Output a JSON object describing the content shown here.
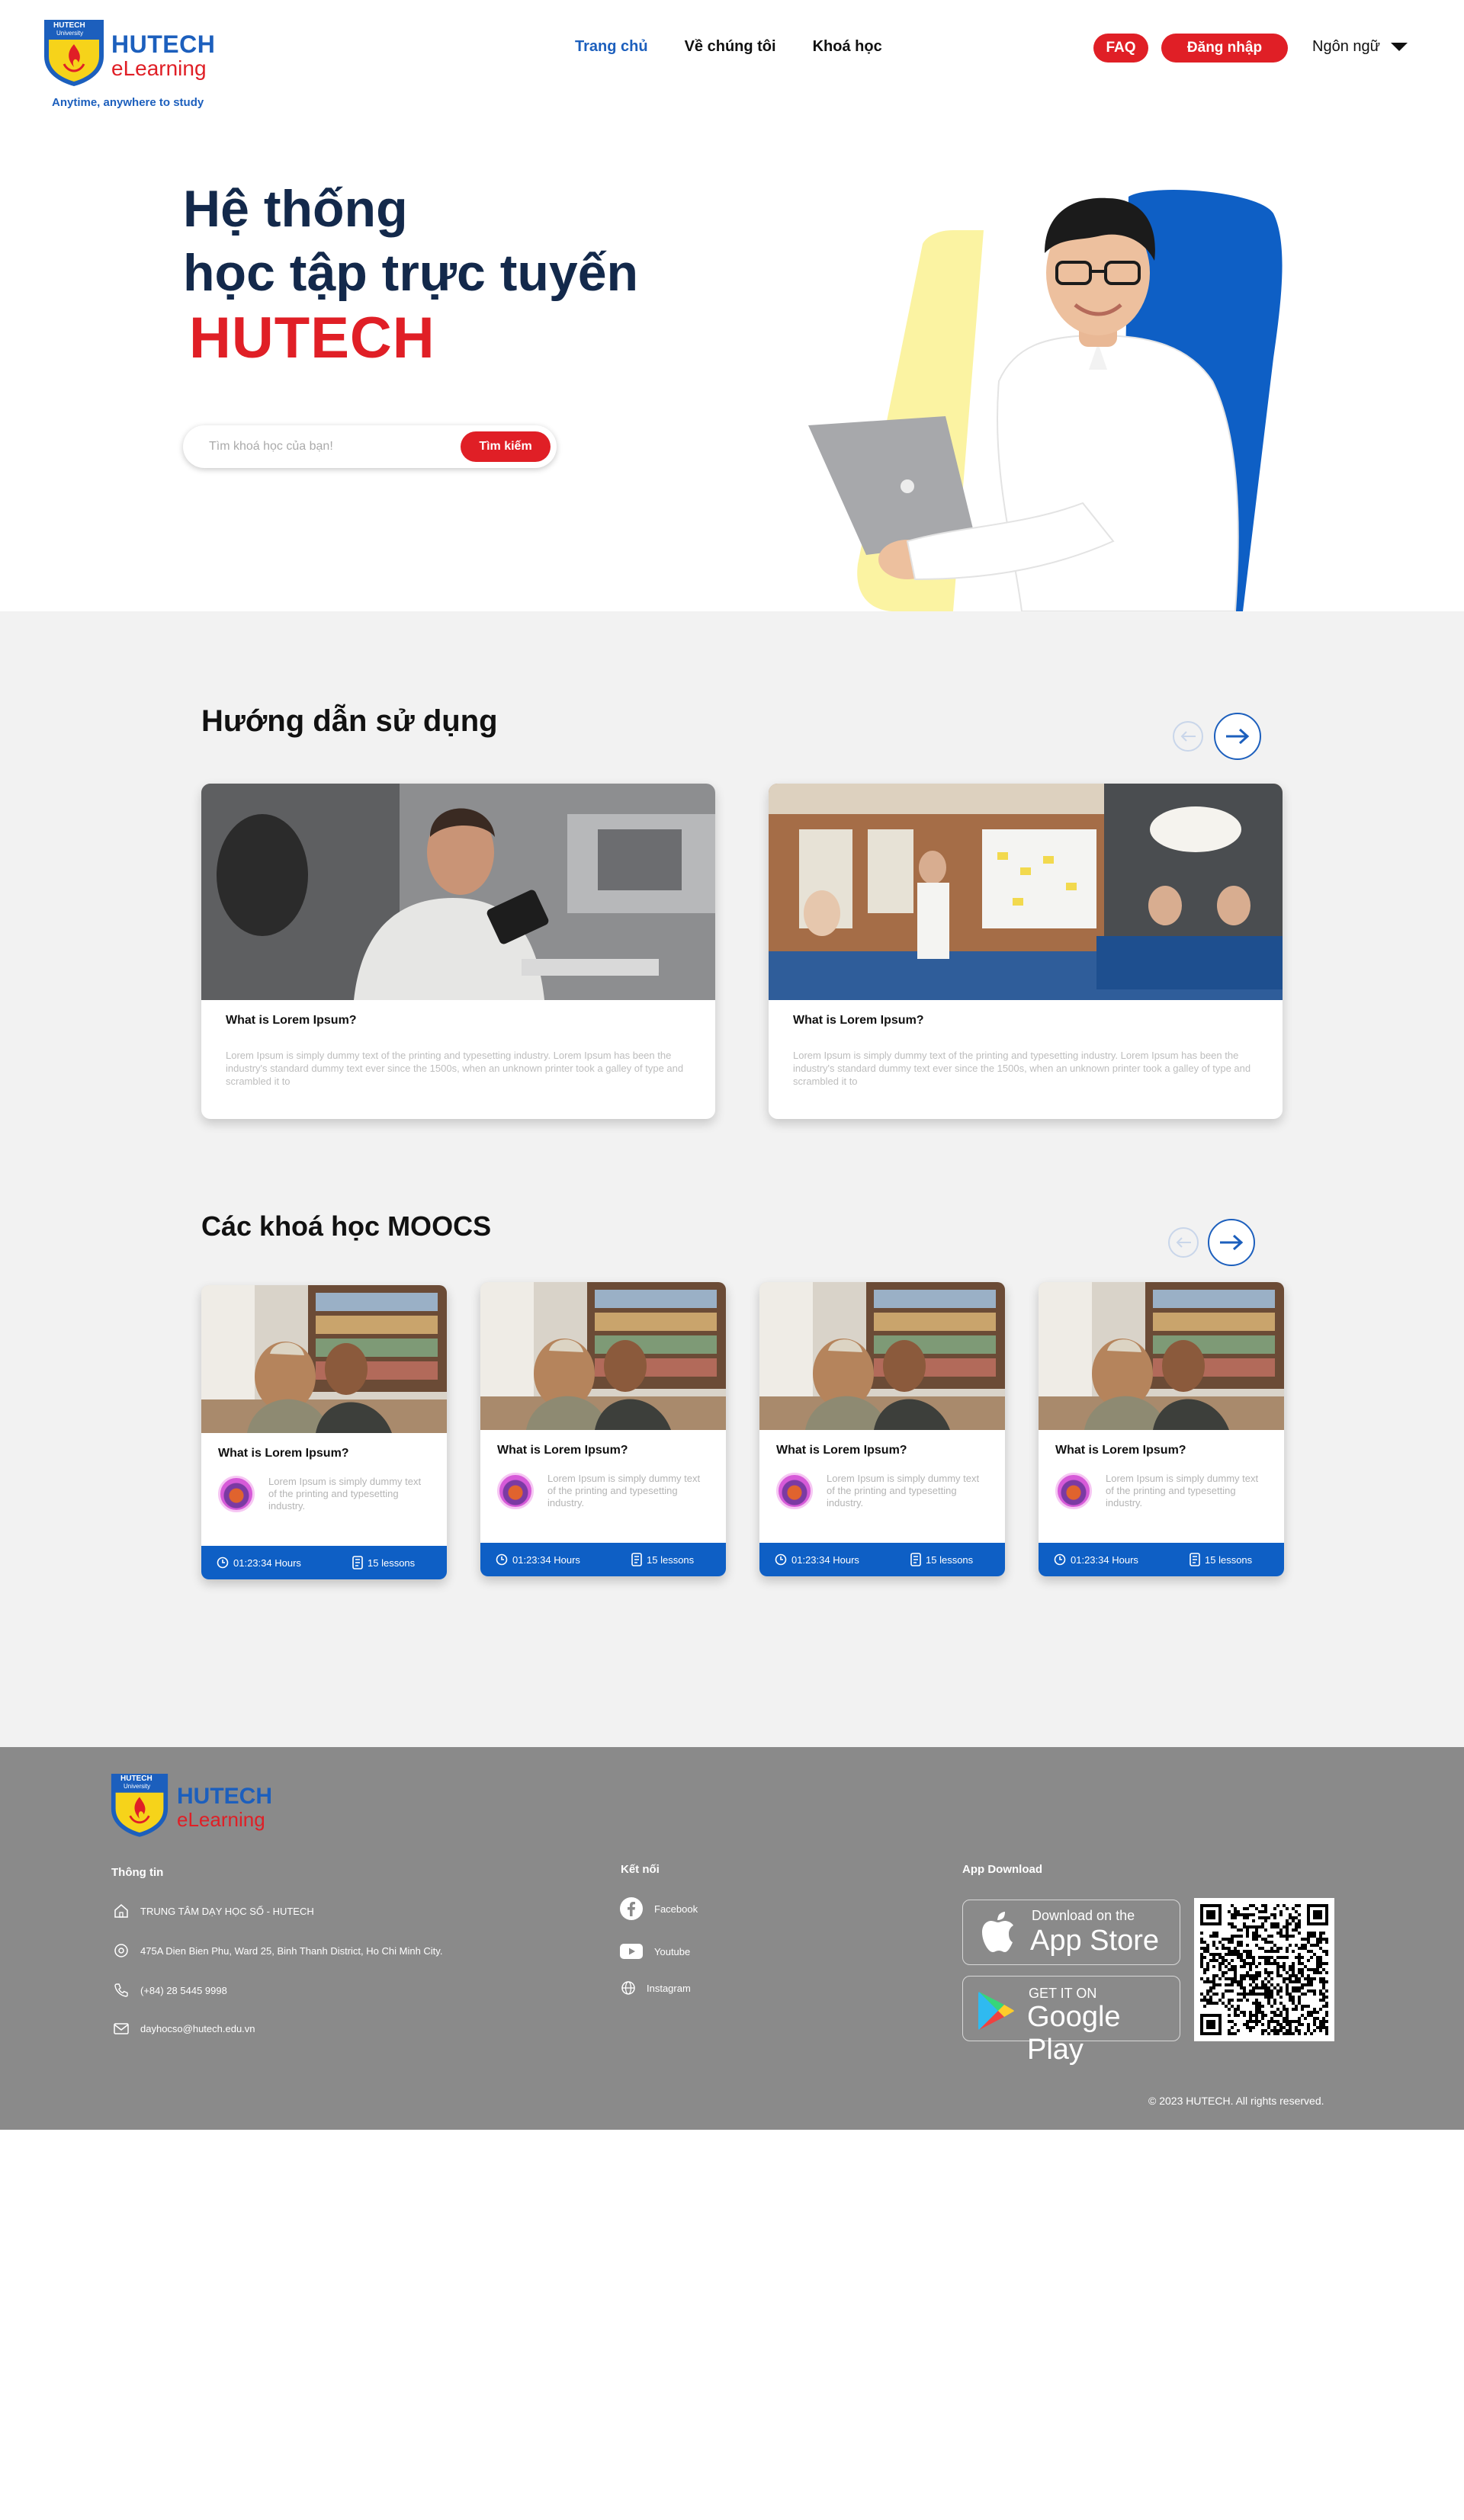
{
  "brand": {
    "badge_line1": "HUTECH",
    "badge_line2": "University",
    "name": "HUTECH",
    "product": "eLearning",
    "tagline": "Anytime, anywhere to study",
    "colors": {
      "blue": "#1c5fbd",
      "red": "#e01f26",
      "navy": "#13294b"
    }
  },
  "nav": {
    "items": [
      {
        "label": "Trang chủ",
        "active": true
      },
      {
        "label": "Về chúng tôi",
        "active": false
      },
      {
        "label": "Khoá học",
        "active": false
      }
    ],
    "faq_label": "FAQ",
    "login_label": "Đăng nhập",
    "language_label": "Ngôn ngữ"
  },
  "hero": {
    "title_line1": "Hệ thống",
    "title_line2": "học tập trực tuyến",
    "title_brand": "HUTECH",
    "search_placeholder": "Tìm khoá học của bạn!",
    "search_button": "Tìm kiếm"
  },
  "guide": {
    "title": "Hướng dẫn sử dụng",
    "cards": [
      {
        "title": "What is Lorem Ipsum?",
        "text": "Lorem Ipsum is simply dummy text of the printing and typesetting industry. Lorem Ipsum has been the industry's standard dummy text ever since the 1500s, when an unknown printer took a galley of type and scrambled it to"
      },
      {
        "title": "What is Lorem Ipsum?",
        "text": "Lorem Ipsum is simply dummy text of the printing and typesetting industry. Lorem Ipsum has been the industry's standard dummy text ever since the 1500s, when an unknown printer took a galley of type and scrambled it to"
      }
    ]
  },
  "moocs": {
    "title": "Các khoá học MOOCS",
    "cards": [
      {
        "title": "What is Lorem Ipsum?",
        "text": "Lorem Ipsum is simply dummy text of the printing and typesetting industry.",
        "duration": "01:23:34 Hours",
        "lessons": "15 lessons"
      },
      {
        "title": "What is Lorem Ipsum?",
        "text": "Lorem Ipsum is simply dummy text of the printing and typesetting industry.",
        "duration": "01:23:34 Hours",
        "lessons": "15 lessons"
      },
      {
        "title": "What is Lorem Ipsum?",
        "text": "Lorem Ipsum is simply dummy text of the printing and typesetting industry.",
        "duration": "01:23:34 Hours",
        "lessons": "15 lessons"
      },
      {
        "title": "What is Lorem Ipsum?",
        "text": "Lorem Ipsum is simply dummy text of the printing and typesetting industry.",
        "duration": "01:23:34 Hours",
        "lessons": "15 lessons"
      }
    ]
  },
  "footer": {
    "info_heading": "Thông tin",
    "info": {
      "center": "TRUNG TÂM DẠY HỌC SỐ - HUTECH",
      "address": "475A Dien Bien Phu, Ward 25, Binh Thanh District, Ho Chi Minh City.",
      "phone": "(+84) 28 5445 9998",
      "email": "dayhocso@hutech.edu.vn"
    },
    "connect_heading": "Kết nối",
    "social": [
      "Facebook",
      "Youtube",
      "Instagram"
    ],
    "app_heading": "App Download",
    "app_store": {
      "small": "Download on the",
      "big": "App Store"
    },
    "google_play": {
      "small": "GET IT ON",
      "big": "Google Play"
    },
    "copyright": "© 2023 HUTECH. All rights reserved."
  }
}
